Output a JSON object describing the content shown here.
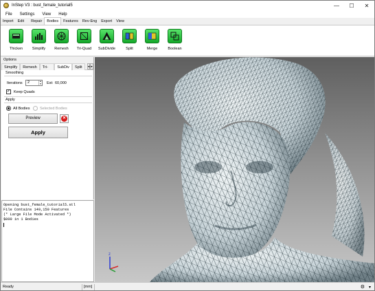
{
  "window": {
    "title": "InStep V3 : bust_female_tutorial5",
    "minimize": "—",
    "maximize": "☐",
    "close": "✕"
  },
  "menu": [
    "File",
    "Settings",
    "View",
    "Help"
  ],
  "ribbon_tabs": [
    {
      "label": "Import",
      "active": false
    },
    {
      "label": "Edit",
      "active": false
    },
    {
      "label": "Repair",
      "active": false
    },
    {
      "label": "Bodies",
      "active": true
    },
    {
      "label": "Features",
      "active": false
    },
    {
      "label": "Rev-Eng",
      "active": false
    },
    {
      "label": "Export",
      "active": false
    },
    {
      "label": "View",
      "active": false
    }
  ],
  "toolbar": [
    {
      "label": "Thicken",
      "icon": "thicken-icon"
    },
    {
      "label": "Simplify",
      "icon": "simplify-icon"
    },
    {
      "label": "Remesh",
      "icon": "remesh-icon"
    },
    {
      "label": "Tri-Quad",
      "icon": "tri-quad-icon"
    },
    {
      "label": "SubDivide",
      "icon": "subdivide-icon"
    },
    {
      "label": "Split",
      "icon": "split-icon"
    },
    {
      "label": "Merge",
      "icon": "merge-icon"
    },
    {
      "label": "Boolean",
      "icon": "boolean-icon"
    }
  ],
  "options": {
    "title": "Options",
    "subtabs": [
      {
        "label": "Simplify",
        "active": false
      },
      {
        "label": "Remesh",
        "active": false
      },
      {
        "label": "Tri-Quad",
        "active": false
      },
      {
        "label": "SubDiv",
        "active": true
      },
      {
        "label": "Split",
        "active": false
      }
    ],
    "scroll_left": "◂",
    "scroll_right": "▸",
    "smoothing_title": "Smoothing",
    "iterations_label": "Iterations",
    "iterations_value": "2",
    "est_label": "Est:",
    "est_value": "60,000",
    "keep_quads_label": "Keep Quads",
    "keep_quads_checked": "✓",
    "apply_title": "Apply",
    "all_bodies_label": "All Bodies",
    "selected_bodies_label": "Selected Bodies",
    "preview_label": "Preview",
    "cancel_glyph": "✕",
    "apply_label": "Apply"
  },
  "console": {
    "lines": [
      "Opening bust_female_tutorial5.stl",
      "File Contains 149,150 Features",
      "(* Large File Mode Activated *)",
      "$000 in 1 Bodies"
    ]
  },
  "status": {
    "ready": "Ready",
    "units": "[mm]",
    "dropdown": "▾"
  },
  "colors": {
    "accent_green": "#22c23a",
    "viewport_bg": "#8a8a8a",
    "mesh_surface": "#d7e2e6",
    "mesh_lines": "#1a2a30",
    "close_red": "#d71a1a"
  }
}
